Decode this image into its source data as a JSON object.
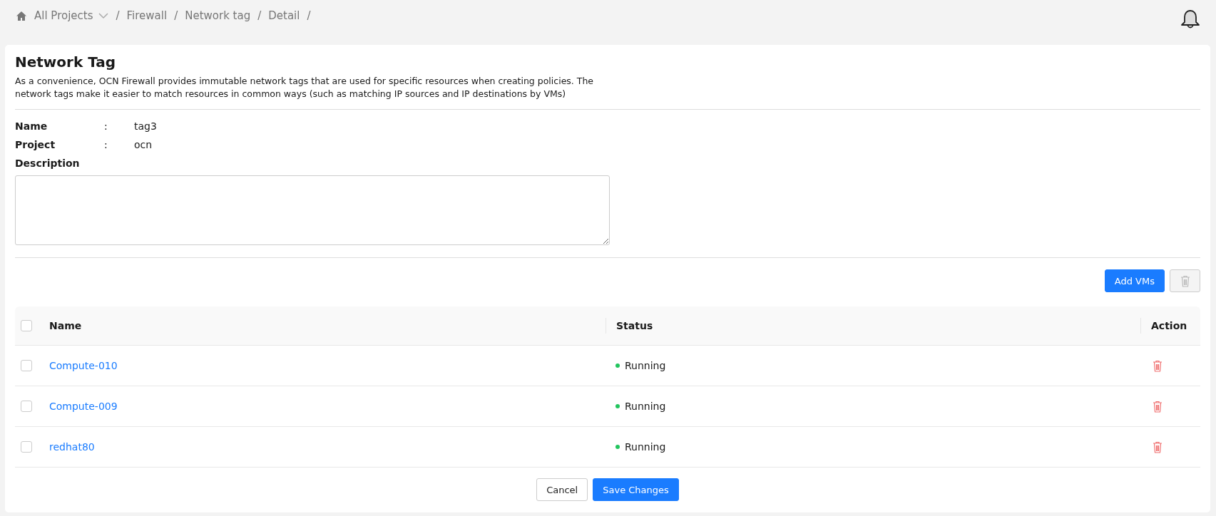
{
  "breadcrumb": [
    {
      "label": "All Projects",
      "kind": "dropdown"
    },
    {
      "label": "Firewall",
      "kind": "link"
    },
    {
      "label": "Network tag",
      "kind": "link"
    },
    {
      "label": "Detail",
      "kind": "link"
    }
  ],
  "separator": "/",
  "title": "Network Tag",
  "description": "As a convenience, OCN Firewall provides immutable network tags that are used for specific resources when creating policies. The network tags make it easier to match resources in common ways (such as matching IP sources and IP destinations by VMs)",
  "fields": [
    {
      "label": "Name",
      "colon": ":",
      "value": "tag3"
    },
    {
      "label": "Project",
      "colon": ":",
      "value": "ocn"
    }
  ],
  "description_field": {
    "label": "Description"
  },
  "toolbar": {
    "add_label": "Add VMs",
    "bulk_delete_disabled": true
  },
  "table": {
    "select_all_checked": false,
    "columns": [
      "Name",
      "Status",
      "Action"
    ],
    "rows": [
      {
        "checked": false,
        "name": "Compute-010",
        "status": "Running",
        "color": "#22c55e"
      },
      {
        "checked": false,
        "name": "Compute-009",
        "status": "Running",
        "color": "#22c55e"
      },
      {
        "checked": false,
        "name": "redhat80",
        "status": "Running",
        "color": "#22c55e"
      }
    ]
  },
  "footer": {
    "cancel": "Cancel",
    "save": "Save Changes"
  }
}
